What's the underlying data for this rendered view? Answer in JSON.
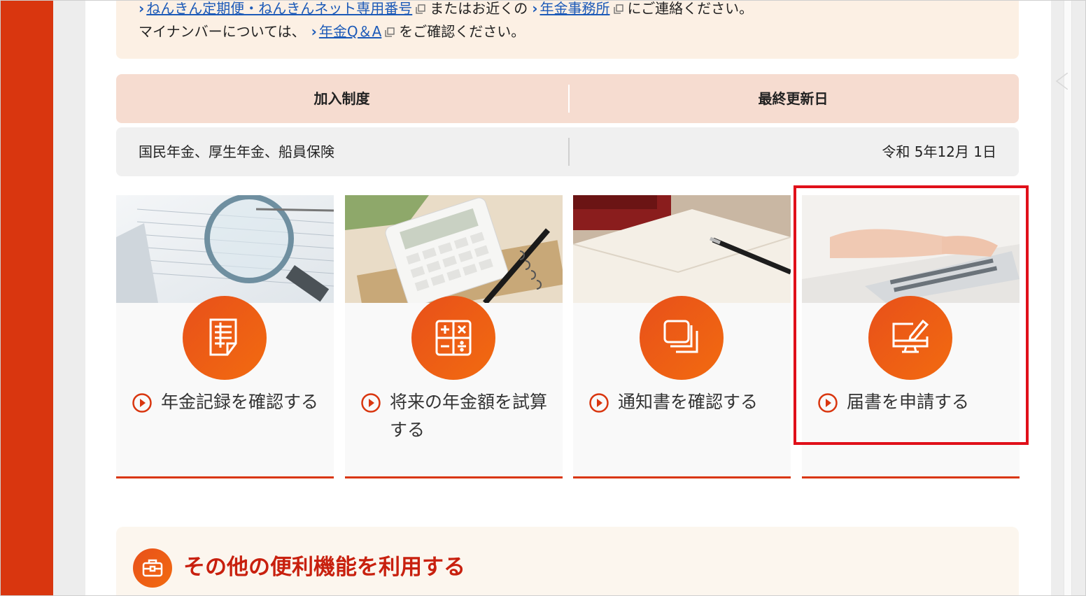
{
  "notice": {
    "line1_link1": "ねんきん定期便・ねんきんネット専用番号",
    "line1_text1": "またはお近くの",
    "line1_link2": "年金事務所",
    "line1_text2": "にご連絡ください。",
    "line2_text1": "マイナンバーについては、",
    "line2_link": "年金Q＆A",
    "line2_text2": "をご確認ください。"
  },
  "table": {
    "headers": [
      "加入制度",
      "最終更新日"
    ],
    "row": [
      "国民年金、厚生年金、船員保険",
      "令和 5年12月 1日"
    ]
  },
  "cards": [
    {
      "label": "年金記録を確認する",
      "icon": "document-list-icon",
      "photo": "magnifier-photo"
    },
    {
      "label": "将来の年金額を試算する",
      "icon": "calculator-icon",
      "photo": "calculator-photo"
    },
    {
      "label": "通知書を確認する",
      "icon": "stacked-documents-icon",
      "photo": "envelope-photo"
    },
    {
      "label": "届書を申請する",
      "icon": "monitor-pencil-icon",
      "photo": "keyboard-photo"
    }
  ],
  "bottom": {
    "title": "その他の便利機能を利用する",
    "icon": "toolbox-icon"
  },
  "colors": {
    "accent": "#d9360f",
    "orange": "#f26b10",
    "link": "#1c5ab8",
    "highlight": "#e0101a",
    "title_red": "#c8200e"
  }
}
